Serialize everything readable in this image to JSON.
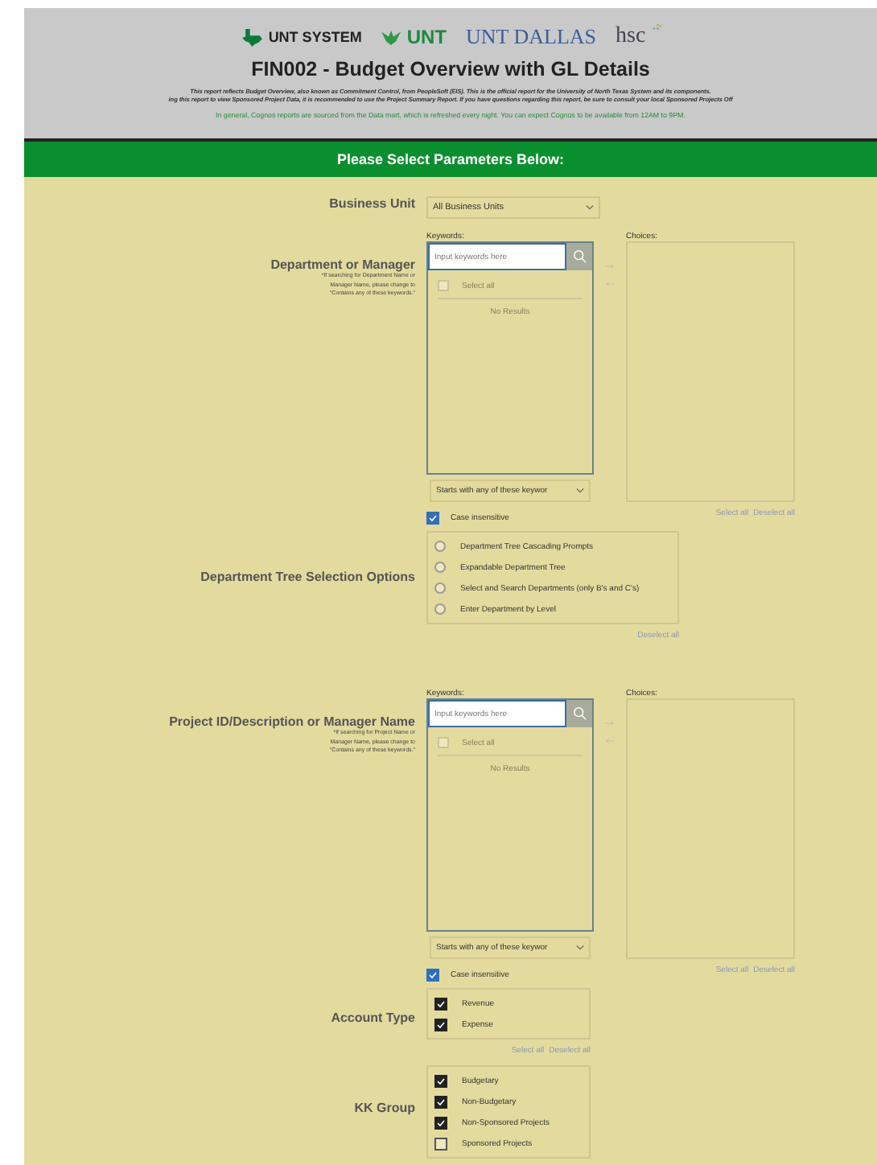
{
  "header": {
    "logos": [
      "UNT SYSTEM",
      "UNT",
      "UNT DALLAS",
      "hsc"
    ],
    "title": "FIN002 - Budget Overview with GL Details",
    "notice_lines": [
      "This report reflects Budget Overview, also known as Commitment Control, from PeopleSoft (EIS). This is the official report for the University of North Texas System and its components.",
      "ing this report to view Sponsored Project Data, it is recommended to use the Project Summary Report. If you have questions regarding this report, be sure to consult your local Sponsored Projects Off"
    ],
    "info": "In general, Cognos reports are sourced from the Data mart, which is refreshed every night. You can expect Cognos to be available from 12AM to 9PM."
  },
  "banner": "Please Select Parameters Below:",
  "parameters": [
    {
      "kind": "select",
      "label": "Business Unit",
      "value": "All Business Units"
    },
    {
      "kind": "search",
      "label": "Department or Manager",
      "note_lines": [
        "*If searching for Department Name or",
        "Manager Name, please change to",
        "\"Contains any of these keywords.\""
      ],
      "keywords_label": "Keywords:",
      "placeholder": "Input keywords here",
      "select_all": "Select all",
      "select_all_checked": false,
      "empty": "No Results",
      "choices_label": "Choices:",
      "match_mode": "Starts with any of these keywor",
      "case_label": "Case insensitive",
      "case_checked": true,
      "links": [
        "Select all",
        "Deselect all"
      ]
    },
    {
      "kind": "radio",
      "label": "Department Tree Selection Options",
      "options": [
        {
          "label": "Department Tree Cascading Prompts",
          "selected": false
        },
        {
          "label": "Expandable Department Tree",
          "selected": false
        },
        {
          "label": "Select and Search Departments (only B's and C's)",
          "selected": false
        },
        {
          "label": "Enter Department by Level",
          "selected": false
        }
      ],
      "links": [
        "Deselect all"
      ]
    },
    {
      "kind": "search",
      "label": "Project ID/Description or Manager Name",
      "note_lines": [
        "*If searching for Project Name or",
        "Manager Name, please change to",
        "\"Contains any of these keywords.\""
      ],
      "keywords_label": "Keywords:",
      "placeholder": "Input keywords here",
      "select_all": "Select all",
      "select_all_checked": false,
      "empty": "No Results",
      "choices_label": "Choices:",
      "match_mode": "Starts with any of these keywor",
      "case_label": "Case insensitive",
      "case_checked": true,
      "links": [
        "Select all",
        "Deselect all"
      ]
    },
    {
      "kind": "checks",
      "label": "Account Type",
      "options": [
        {
          "label": "Revenue",
          "checked": true
        },
        {
          "label": "Expense",
          "checked": true
        }
      ],
      "links": [
        "Select all",
        "Deselect all"
      ]
    },
    {
      "kind": "checks",
      "label": "KK Group",
      "options": [
        {
          "label": "Budgetary",
          "checked": true
        },
        {
          "label": "Non-Budgetary",
          "checked": true
        },
        {
          "label": "Non-Sponsored Projects",
          "checked": true
        },
        {
          "label": "Sponsored Projects",
          "checked": false
        }
      ]
    }
  ]
}
